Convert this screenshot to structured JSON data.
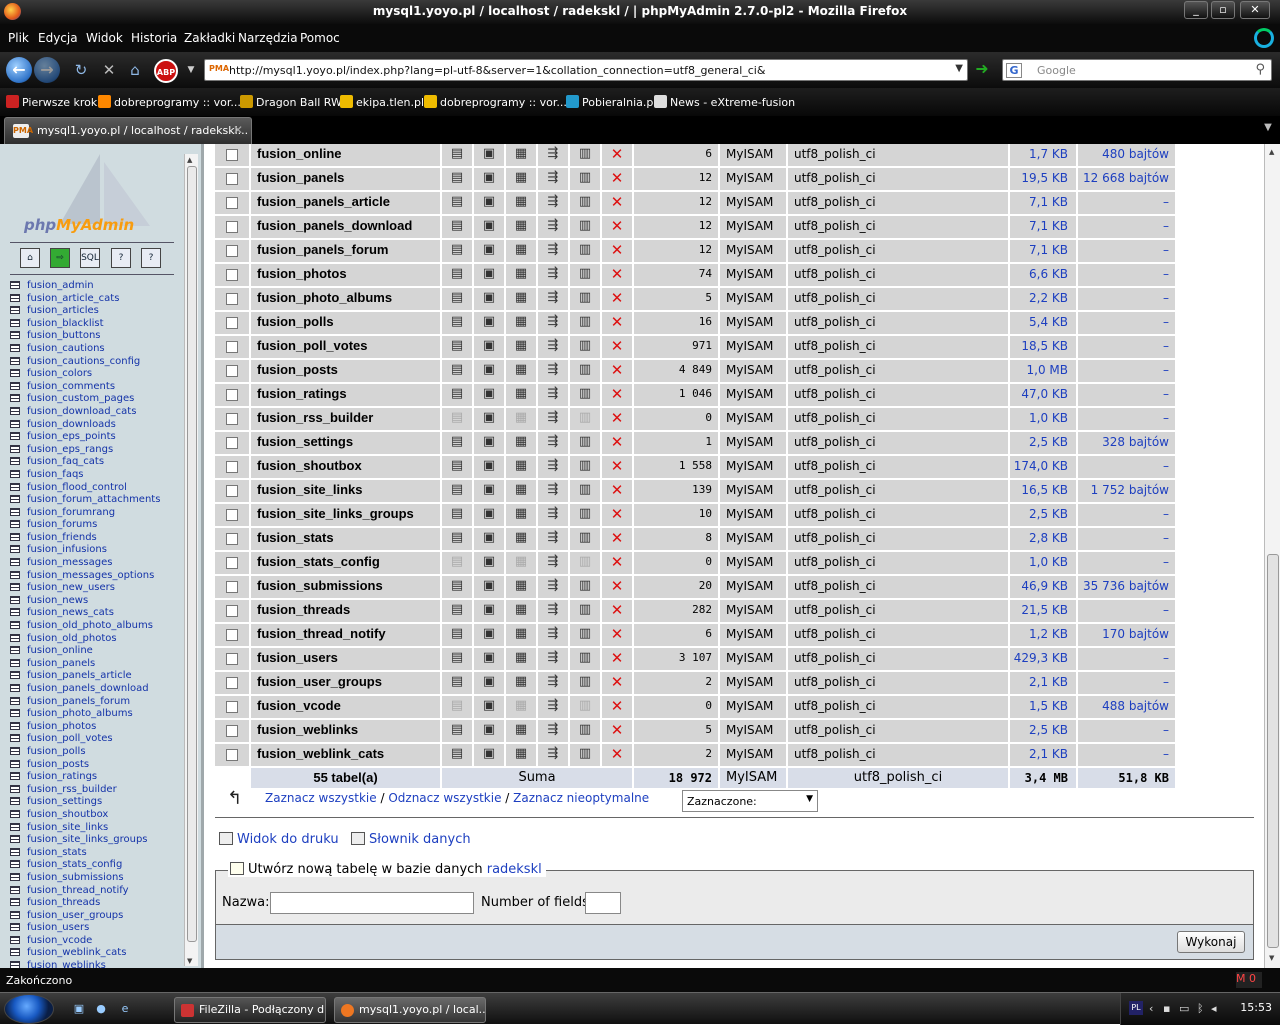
{
  "window": {
    "title": "mysql1.yoyo.pl / localhost / radekskl / | phpMyAdmin 2.7.0-pl2 - Mozilla Firefox"
  },
  "menu": [
    "Plik",
    "Edycja",
    "Widok",
    "Historia",
    "Zakładki",
    "Narzędzia",
    "Pomoc"
  ],
  "nav": {
    "url": "http://mysql1.yoyo.pl/index.php?lang=pl-utf-8&server=1&collation_connection=utf8_general_ci&",
    "search_placeholder": "Google"
  },
  "bookmarks": [
    {
      "label": "Pierwsze kroki",
      "color": "#c22"
    },
    {
      "label": "dobreprogramy :: vor...",
      "color": "#f80"
    },
    {
      "label": "Dragon Ball RW",
      "color": "#c90"
    },
    {
      "label": "ekipa.tlen.pl",
      "color": "#eb0"
    },
    {
      "label": "dobreprogramy :: vor...",
      "color": "#eb0"
    },
    {
      "label": "Pobieralnia.pl",
      "color": "#29c"
    },
    {
      "label": "News - eXtreme-fusion",
      "color": "#ddd"
    }
  ],
  "tab": {
    "title": "mysql1.yoyo.pl / localhost / radekskl..."
  },
  "sidebar": {
    "logo_a": "php",
    "logo_b": "MyAdmin",
    "quick_icons": [
      "home-icon",
      "exit-icon",
      "sql-icon",
      "help-icon",
      "docs-icon"
    ],
    "tables": [
      "fusion_admin",
      "fusion_article_cats",
      "fusion_articles",
      "fusion_blacklist",
      "fusion_buttons",
      "fusion_cautions",
      "fusion_cautions_config",
      "fusion_colors",
      "fusion_comments",
      "fusion_custom_pages",
      "fusion_download_cats",
      "fusion_downloads",
      "fusion_eps_points",
      "fusion_eps_rangs",
      "fusion_faq_cats",
      "fusion_faqs",
      "fusion_flood_control",
      "fusion_forum_attachments",
      "fusion_forumrang",
      "fusion_forums",
      "fusion_friends",
      "fusion_infusions",
      "fusion_messages",
      "fusion_messages_options",
      "fusion_new_users",
      "fusion_news",
      "fusion_news_cats",
      "fusion_old_photo_albums",
      "fusion_old_photos",
      "fusion_online",
      "fusion_panels",
      "fusion_panels_article",
      "fusion_panels_download",
      "fusion_panels_forum",
      "fusion_photo_albums",
      "fusion_photos",
      "fusion_poll_votes",
      "fusion_polls",
      "fusion_posts",
      "fusion_ratings",
      "fusion_rss_builder",
      "fusion_settings",
      "fusion_shoutbox",
      "fusion_site_links",
      "fusion_site_links_groups",
      "fusion_stats",
      "fusion_stats_config",
      "fusion_submissions",
      "fusion_thread_notify",
      "fusion_threads",
      "fusion_user_groups",
      "fusion_users",
      "fusion_vcode",
      "fusion_weblink_cats",
      "fusion_weblinks"
    ]
  },
  "table_rows": [
    {
      "name": "fusion_online",
      "rows": "6",
      "engine": "MyISAM",
      "collation": "utf8_polish_ci",
      "size": "1,7 KB",
      "overhead": "480 bajtów",
      "empty": false
    },
    {
      "name": "fusion_panels",
      "rows": "12",
      "engine": "MyISAM",
      "collation": "utf8_polish_ci",
      "size": "19,5 KB",
      "overhead": "12 668 bajtów",
      "empty": false
    },
    {
      "name": "fusion_panels_article",
      "rows": "12",
      "engine": "MyISAM",
      "collation": "utf8_polish_ci",
      "size": "7,1 KB",
      "overhead": "–",
      "empty": false
    },
    {
      "name": "fusion_panels_download",
      "rows": "12",
      "engine": "MyISAM",
      "collation": "utf8_polish_ci",
      "size": "7,1 KB",
      "overhead": "–",
      "empty": false
    },
    {
      "name": "fusion_panels_forum",
      "rows": "12",
      "engine": "MyISAM",
      "collation": "utf8_polish_ci",
      "size": "7,1 KB",
      "overhead": "–",
      "empty": false
    },
    {
      "name": "fusion_photos",
      "rows": "74",
      "engine": "MyISAM",
      "collation": "utf8_polish_ci",
      "size": "6,6 KB",
      "overhead": "–",
      "empty": false
    },
    {
      "name": "fusion_photo_albums",
      "rows": "5",
      "engine": "MyISAM",
      "collation": "utf8_polish_ci",
      "size": "2,2 KB",
      "overhead": "–",
      "empty": false
    },
    {
      "name": "fusion_polls",
      "rows": "16",
      "engine": "MyISAM",
      "collation": "utf8_polish_ci",
      "size": "5,4 KB",
      "overhead": "–",
      "empty": false
    },
    {
      "name": "fusion_poll_votes",
      "rows": "971",
      "engine": "MyISAM",
      "collation": "utf8_polish_ci",
      "size": "18,5 KB",
      "overhead": "–",
      "empty": false
    },
    {
      "name": "fusion_posts",
      "rows": "4 849",
      "engine": "MyISAM",
      "collation": "utf8_polish_ci",
      "size": "1,0 MB",
      "overhead": "–",
      "empty": false
    },
    {
      "name": "fusion_ratings",
      "rows": "1 046",
      "engine": "MyISAM",
      "collation": "utf8_polish_ci",
      "size": "47,0 KB",
      "overhead": "–",
      "empty": false
    },
    {
      "name": "fusion_rss_builder",
      "rows": "0",
      "engine": "MyISAM",
      "collation": "utf8_polish_ci",
      "size": "1,0 KB",
      "overhead": "–",
      "empty": true
    },
    {
      "name": "fusion_settings",
      "rows": "1",
      "engine": "MyISAM",
      "collation": "utf8_polish_ci",
      "size": "2,5 KB",
      "overhead": "328 bajtów",
      "empty": false
    },
    {
      "name": "fusion_shoutbox",
      "rows": "1 558",
      "engine": "MyISAM",
      "collation": "utf8_polish_ci",
      "size": "174,0 KB",
      "overhead": "–",
      "empty": false
    },
    {
      "name": "fusion_site_links",
      "rows": "139",
      "engine": "MyISAM",
      "collation": "utf8_polish_ci",
      "size": "16,5 KB",
      "overhead": "1 752 bajtów",
      "empty": false
    },
    {
      "name": "fusion_site_links_groups",
      "rows": "10",
      "engine": "MyISAM",
      "collation": "utf8_polish_ci",
      "size": "2,5 KB",
      "overhead": "–",
      "empty": false
    },
    {
      "name": "fusion_stats",
      "rows": "8",
      "engine": "MyISAM",
      "collation": "utf8_polish_ci",
      "size": "2,8 KB",
      "overhead": "–",
      "empty": false
    },
    {
      "name": "fusion_stats_config",
      "rows": "0",
      "engine": "MyISAM",
      "collation": "utf8_polish_ci",
      "size": "1,0 KB",
      "overhead": "–",
      "empty": true
    },
    {
      "name": "fusion_submissions",
      "rows": "20",
      "engine": "MyISAM",
      "collation": "utf8_polish_ci",
      "size": "46,9 KB",
      "overhead": "35 736 bajtów",
      "empty": false
    },
    {
      "name": "fusion_threads",
      "rows": "282",
      "engine": "MyISAM",
      "collation": "utf8_polish_ci",
      "size": "21,5 KB",
      "overhead": "–",
      "empty": false
    },
    {
      "name": "fusion_thread_notify",
      "rows": "6",
      "engine": "MyISAM",
      "collation": "utf8_polish_ci",
      "size": "1,2 KB",
      "overhead": "170 bajtów",
      "empty": false
    },
    {
      "name": "fusion_users",
      "rows": "3 107",
      "engine": "MyISAM",
      "collation": "utf8_polish_ci",
      "size": "429,3 KB",
      "overhead": "–",
      "empty": false
    },
    {
      "name": "fusion_user_groups",
      "rows": "2",
      "engine": "MyISAM",
      "collation": "utf8_polish_ci",
      "size": "2,1 KB",
      "overhead": "–",
      "empty": false
    },
    {
      "name": "fusion_vcode",
      "rows": "0",
      "engine": "MyISAM",
      "collation": "utf8_polish_ci",
      "size": "1,5 KB",
      "overhead": "488 bajtów",
      "empty": true
    },
    {
      "name": "fusion_weblinks",
      "rows": "5",
      "engine": "MyISAM",
      "collation": "utf8_polish_ci",
      "size": "2,5 KB",
      "overhead": "–",
      "empty": false
    },
    {
      "name": "fusion_weblink_cats",
      "rows": "2",
      "engine": "MyISAM",
      "collation": "utf8_polish_ci",
      "size": "2,1 KB",
      "overhead": "–",
      "empty": false
    }
  ],
  "summary": {
    "tables": "55 tabel(a)",
    "label": "Suma",
    "rows": "18 972",
    "engine": "MyISAM",
    "collation": "utf8_polish_ci",
    "size": "3,4 MB",
    "overhead": "51,8 KB"
  },
  "select": {
    "check_all": "Zaznacz wszystkie",
    "uncheck_all": "Odznacz wszystkie",
    "check_overhead": "Zaznacz nieoptymalne",
    "with_selected": "Zaznaczone:"
  },
  "links": {
    "print": "Widok do druku",
    "dictionary": "Słownik danych"
  },
  "create": {
    "legend": "Utwórz nową tabelę w bazie danych",
    "db": "radekskl",
    "name_label": "Nazwa:",
    "fields_label": "Number of fields:",
    "go": "Wykonaj"
  },
  "status": {
    "text": "Zakończono"
  },
  "taskbar": {
    "tasks": [
      {
        "label": "FileZilla - Podłączony d...",
        "color": "#c33"
      },
      {
        "label": "mysql1.yoyo.pl / local...",
        "color": "#e72"
      }
    ],
    "tray_lang": "PL",
    "clock": "15:53"
  },
  "colors": {
    "link": "#1d3fc0",
    "row_bg": "#d5d5d5",
    "summary_bg": "#d8dde8",
    "sidebar_bg": "#d0dce0"
  }
}
